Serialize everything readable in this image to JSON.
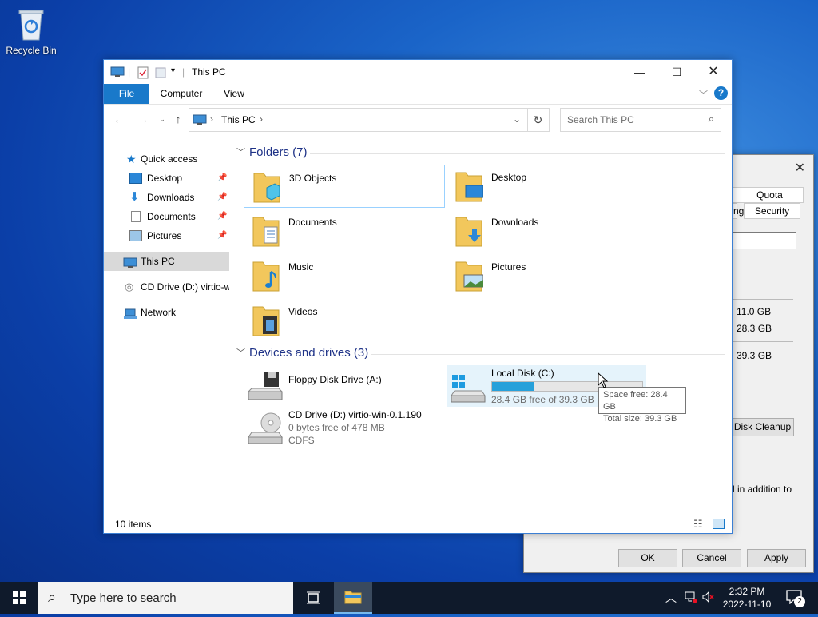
{
  "desktop": {
    "recycle_bin": "Recycle Bin"
  },
  "explorer": {
    "title": "This PC",
    "ribbon": {
      "file": "File",
      "computer": "Computer",
      "view": "View"
    },
    "address": {
      "location": "This PC"
    },
    "search": {
      "placeholder": "Search This PC"
    },
    "nav": {
      "quick_access": "Quick access",
      "desktop": "Desktop",
      "downloads": "Downloads",
      "documents": "Documents",
      "pictures": "Pictures",
      "this_pc": "This PC",
      "cd_drive": "CD Drive (D:) virtio-w",
      "network": "Network"
    },
    "folders_header": "Folders (7)",
    "folders": [
      "3D Objects",
      "Desktop",
      "Documents",
      "Downloads",
      "Music",
      "Pictures",
      "Videos"
    ],
    "devices_header": "Devices and drives (3)",
    "drives": {
      "floppy": {
        "name": "Floppy Disk Drive (A:)"
      },
      "local": {
        "name": "Local Disk (C:)",
        "free": "28.4 GB free of 39.3 GB",
        "used_fraction": 0.28
      },
      "cd": {
        "name": "CD Drive (D:) virtio-win-0.1.190",
        "free": "0 bytes free of 478 MB",
        "fs": "CDFS"
      }
    },
    "status": "10 items"
  },
  "tooltip": {
    "line1": "Space free: 28.4 GB",
    "line2": "Total size: 39.3 GB"
  },
  "properties": {
    "tab_quota": "Quota",
    "tab_partial": "ng",
    "tab_security": "Security",
    "val1": "11.0 GB",
    "val2": "28.3 GB",
    "val3": "39.3 GB",
    "disk_cleanup": "Disk Cleanup",
    "text_tail": "d in addition to",
    "ok": "OK",
    "cancel": "Cancel",
    "apply": "Apply"
  },
  "taskbar": {
    "search_placeholder": "Type here to search",
    "time": "2:32 PM",
    "date": "2022-11-10",
    "notifications": "2"
  }
}
